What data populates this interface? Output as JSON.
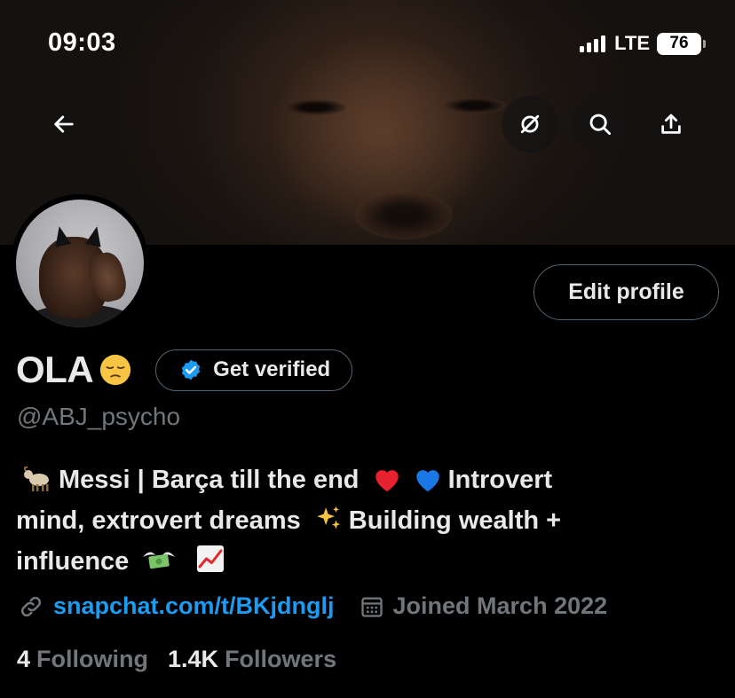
{
  "status_bar": {
    "time": "09:03",
    "network": "LTE",
    "battery": "76"
  },
  "header": {
    "back_icon": "arrow-left-icon",
    "hide_icon": "circle-slash-icon",
    "search_icon": "search-icon",
    "share_icon": "share-upload-icon"
  },
  "profile": {
    "display_name": "OLA",
    "name_emoji": "pensive-face",
    "get_verified_label": "Get verified",
    "handle": "@ABJ_psycho",
    "edit_profile_label": "Edit profile",
    "bio": {
      "line1_text_a": "Messi | Barça till the end",
      "line1_text_b": "Introvert",
      "line2_text_a": "mind, extrovert dreams",
      "line2_text_b": "Building wealth +",
      "line3_text": "influence"
    },
    "link": "snapchat.com/t/BKjdnglj",
    "joined": "Joined March 2022",
    "following_count": "4",
    "following_label": "Following",
    "followers_count": "1.4K",
    "followers_label": "Followers"
  },
  "colors": {
    "background": "#000000",
    "text_primary": "#e7e9ea",
    "text_secondary": "#71767b",
    "accent_blue": "#1d9bf0",
    "border": "#536471"
  }
}
